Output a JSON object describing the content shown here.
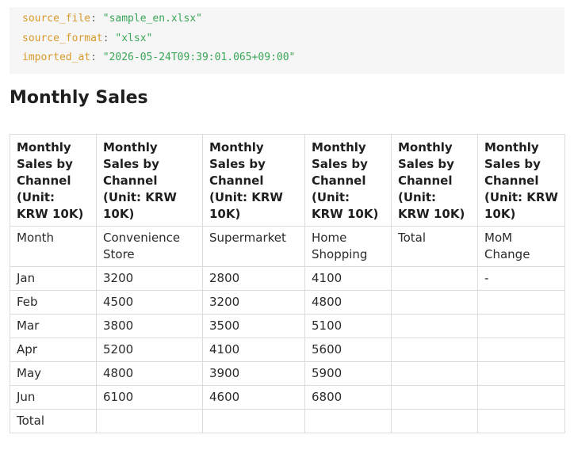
{
  "frontmatter": [
    {
      "key": "source_file",
      "value": "\"sample_en.xlsx\""
    },
    {
      "key": "source_format",
      "value": "\"xlsx\""
    },
    {
      "key": "imported_at",
      "value": "\"2026-05-24T09:39:01.065+09:00\""
    }
  ],
  "page": {
    "title": "Monthly Sales"
  },
  "table": {
    "header_row": [
      "Monthly Sales by Channel (Unit: KRW 10K)",
      "Monthly Sales by Channel (Unit: KRW 10K)",
      "Monthly Sales by Channel (Unit: KRW 10K)",
      "Monthly Sales by Channel (Unit: KRW 10K)",
      "Monthly Sales by Channel (Unit: KRW 10K)",
      "Monthly Sales by Channel (Unit: KRW 10K)"
    ],
    "rows": [
      [
        "Month",
        "Convenience Store",
        "Supermarket",
        "Home Shopping",
        "Total",
        "MoM Change"
      ],
      [
        "Jan",
        "3200",
        "2800",
        "4100",
        "",
        "-"
      ],
      [
        "Feb",
        "4500",
        "3200",
        "4800",
        "",
        ""
      ],
      [
        "Mar",
        "3800",
        "3500",
        "5100",
        "",
        ""
      ],
      [
        "Apr",
        "5200",
        "4100",
        "5600",
        "",
        ""
      ],
      [
        "May",
        "4800",
        "3900",
        "5900",
        "",
        ""
      ],
      [
        "Jun",
        "6100",
        "4600",
        "6800",
        "",
        ""
      ],
      [
        "Total",
        "",
        "",
        "",
        "",
        ""
      ]
    ]
  }
}
